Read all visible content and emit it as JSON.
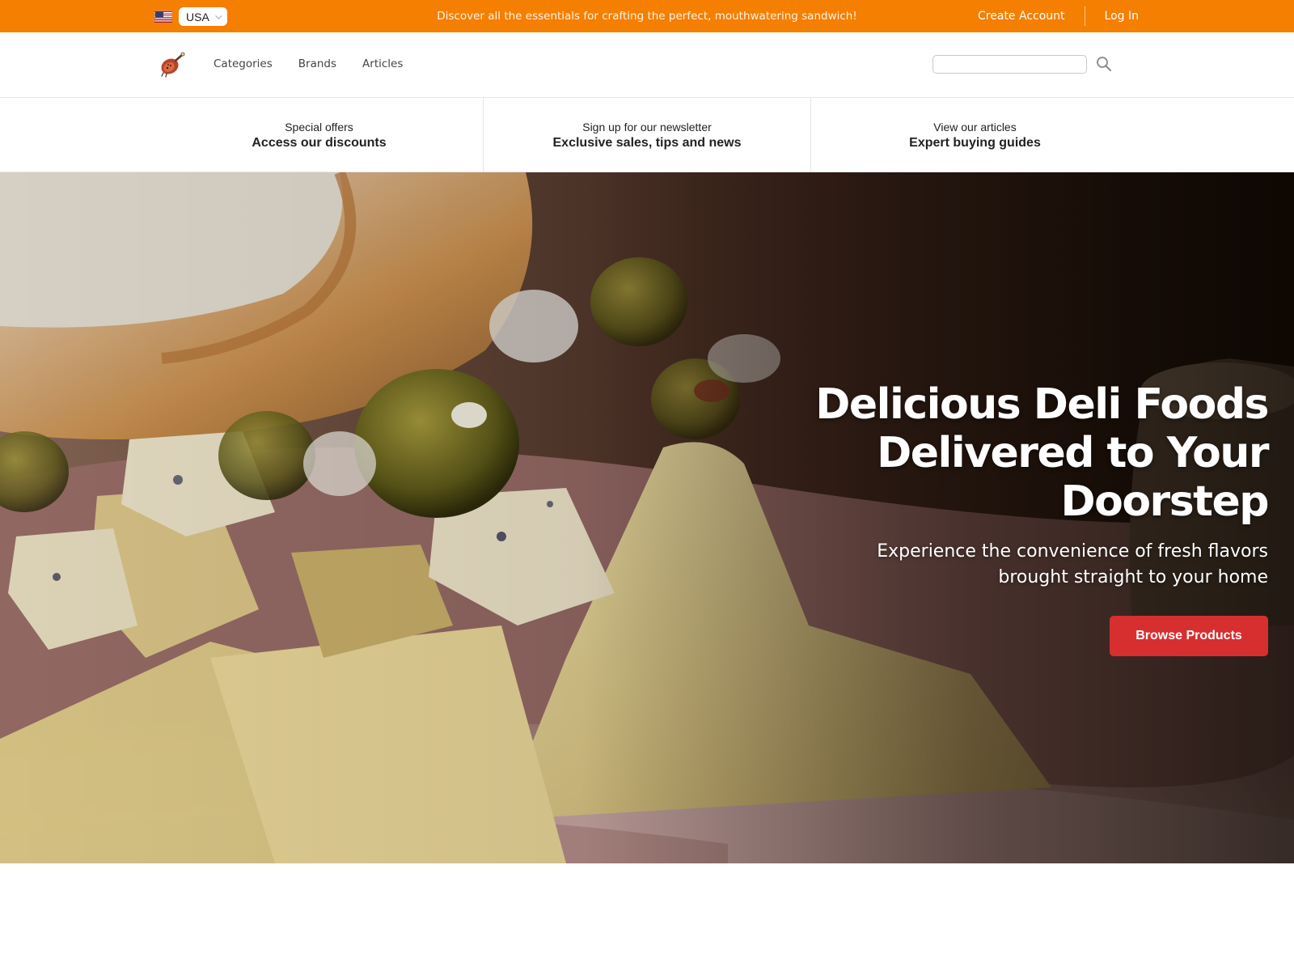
{
  "topbar": {
    "country": "USA",
    "flag_icon": "us-flag-icon",
    "promo": "Discover all the essentials for crafting the perfect, mouthwatering sandwich!",
    "create_account": "Create Account",
    "login": "Log In",
    "background_color": "#f57f00"
  },
  "header": {
    "logo_icon": "ham-leg-logo-icon",
    "nav": [
      "Categories",
      "Brands",
      "Articles"
    ],
    "search_placeholder": "",
    "search_icon": "search-icon"
  },
  "promos": [
    {
      "small": "Special offers",
      "big": "Access our discounts"
    },
    {
      "small": "Sign up for our newsletter",
      "big": "Exclusive sales, tips and news"
    },
    {
      "small": "View our articles",
      "big": "Expert buying guides"
    }
  ],
  "hero": {
    "title_lines": [
      "Delicious Deli Foods",
      "Delivered to Your",
      "Doorstep"
    ],
    "subtitle_lines": [
      "Experience the convenience of fresh flavors",
      "brought straight to your home"
    ],
    "button": "Browse Products",
    "button_color": "#d72f2f",
    "image": "deli-platter-photo"
  }
}
